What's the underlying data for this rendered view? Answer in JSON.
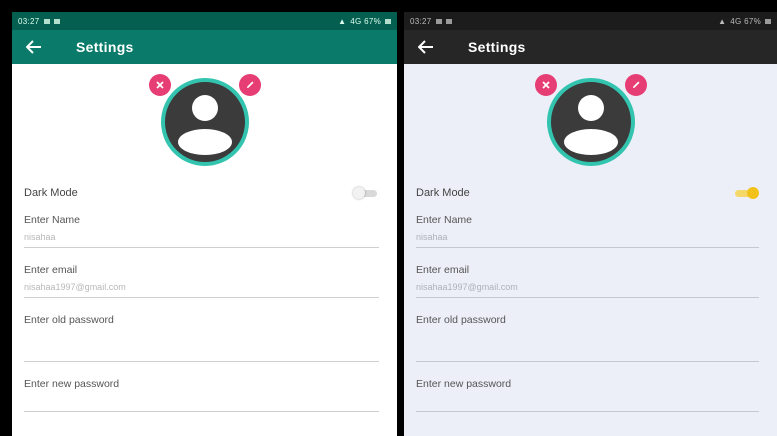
{
  "screens": [
    {
      "theme": "light",
      "status": {
        "time": "03:27",
        "right": "4G 67%"
      },
      "toolbar": {
        "title": "Settings"
      },
      "dark_mode": {
        "label": "Dark Mode",
        "enabled": false
      },
      "fields": [
        {
          "label": "Enter Name",
          "value": "nisahaa"
        },
        {
          "label": "Enter email",
          "value": "nisahaa1997@gmail.com"
        },
        {
          "label": "Enter old password",
          "value": ""
        },
        {
          "label": "Enter new password",
          "value": ""
        }
      ]
    },
    {
      "theme": "dark",
      "status": {
        "time": "03:27",
        "right": "4G 67%"
      },
      "toolbar": {
        "title": "Settings"
      },
      "dark_mode": {
        "label": "Dark Mode",
        "enabled": true
      },
      "fields": [
        {
          "label": "Enter Name",
          "value": "nisahaa"
        },
        {
          "label": "Enter email",
          "value": "nisahaa1997@gmail.com"
        },
        {
          "label": "Enter old password",
          "value": ""
        },
        {
          "label": "Enter new password",
          "value": ""
        }
      ]
    }
  ],
  "colors": {
    "toolbar_light": "#0a7b6a",
    "toolbar_dark": "#262626",
    "accent_ring": "#33c4b0",
    "badge_pink": "#e63e74",
    "toggle_on": "#f2c21b"
  },
  "icons": [
    "back-arrow-icon",
    "close-icon",
    "pencil-icon",
    "avatar-person-icon",
    "signal-icon",
    "battery-icon"
  ]
}
